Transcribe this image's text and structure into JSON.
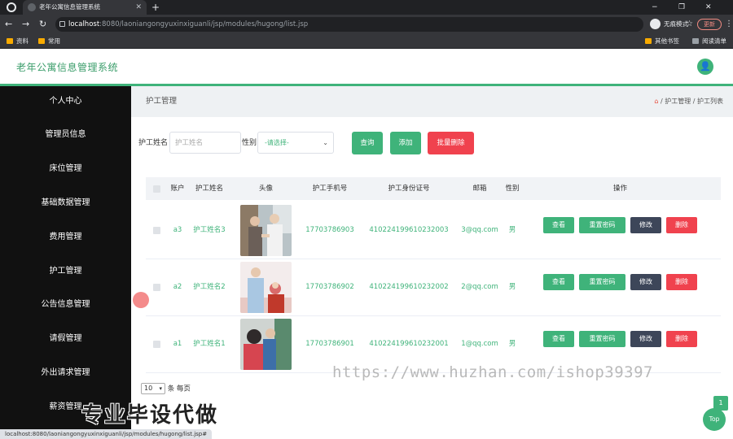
{
  "browser": {
    "tab_title": "老年公寓信息管理系统",
    "tab_close": "✕",
    "new_tab": "+",
    "min": "−",
    "max": "❐",
    "close": "✕",
    "back": "←",
    "forward": "→",
    "reload": "↻",
    "url_host": "localhost",
    "url_path": ":8080/laoniangongyuxinxiguanli/jsp/modules/hugong/list.jsp",
    "star": "☆",
    "incognito_label": "无痕模式",
    "update_label": "更新",
    "more": "⋮",
    "bookmarks": [
      "资料",
      "常用"
    ],
    "other_bookmarks": "其他书签",
    "reading_list": "阅读清单",
    "status_url": "localhost:8080/laoniangongyuxinxiguanli/jsp/modules/hugong/list.jsp#"
  },
  "app": {
    "title": "老年公寓信息管理系统",
    "user_icon": "👤"
  },
  "sidebar": {
    "items": [
      "个人中心",
      "管理员信息",
      "床位管理",
      "基础数据管理",
      "费用管理",
      "护工管理",
      "公告信息管理",
      "请假管理",
      "外出请求管理",
      "薪资管理"
    ]
  },
  "breadcrumb": {
    "title": "护工管理",
    "home": "⌂",
    "trail": " / 护工管理 / 护工列表"
  },
  "search": {
    "name_label": "护工姓名",
    "name_placeholder": "护工姓名",
    "gender_label": "性别",
    "gender_selected": "-请选择-",
    "query_button": "查询",
    "add_button": "添加",
    "batch_delete_button": "批量删除"
  },
  "table": {
    "headers": [
      "账户",
      "护工姓名",
      "头像",
      "护工手机号",
      "护工身份证号",
      "邮箱",
      "性别",
      "操作"
    ],
    "actions": {
      "view": "查看",
      "reset": "重置密码",
      "edit": "修改",
      "delete": "删除"
    },
    "rows": [
      {
        "account": "a3",
        "name": "护工姓名3",
        "phone": "17703786903",
        "id_card": "410224199610232003",
        "email": "3@qq.com",
        "gender": "男"
      },
      {
        "account": "a2",
        "name": "护工姓名2",
        "phone": "17703786902",
        "id_card": "410224199610232002",
        "email": "2@qq.com",
        "gender": "男"
      },
      {
        "account": "a1",
        "name": "护工姓名1",
        "phone": "17703786901",
        "id_card": "410224199610232001",
        "email": "1@qq.com",
        "gender": "男"
      }
    ]
  },
  "pagination": {
    "page_size": "10",
    "per_page_label": "条 每页",
    "current_page": "1",
    "top_label": "Top"
  },
  "overlay": {
    "watermark": "https://www.huzhan.com/ishop39397",
    "promo": "专业毕设代做"
  },
  "colors": {
    "accent": "#3fb37a",
    "danger": "#f0424e",
    "dark_button": "#3d4659",
    "sidebar": "#111111"
  }
}
